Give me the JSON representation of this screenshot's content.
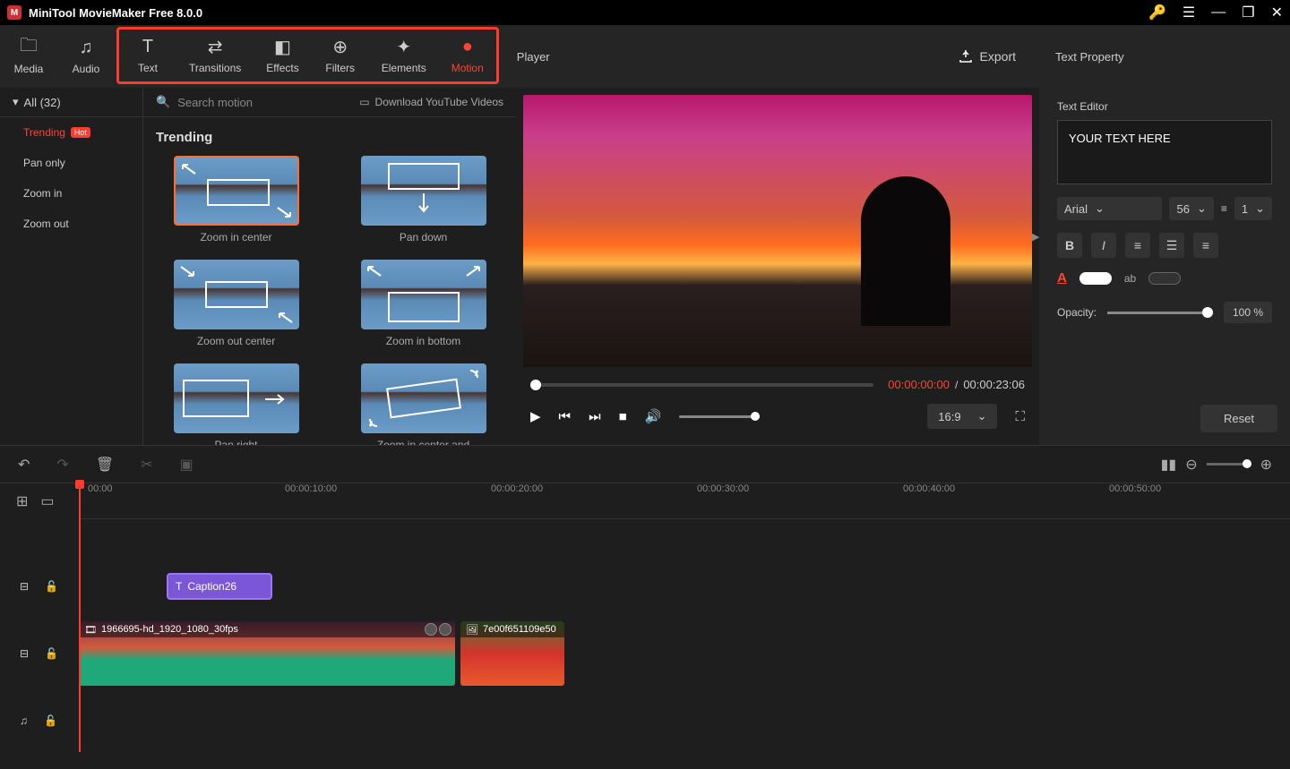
{
  "app": {
    "title": "MiniTool MovieMaker Free 8.0.0"
  },
  "tabs": {
    "media": "Media",
    "audio": "Audio",
    "text": "Text",
    "transitions": "Transitions",
    "effects": "Effects",
    "filters": "Filters",
    "elements": "Elements",
    "motion": "Motion"
  },
  "player_label": "Player",
  "export_label": "Export",
  "right_header": "Text Property",
  "categories": {
    "header": "All (32)",
    "items": [
      "Trending",
      "Pan only",
      "Zoom in",
      "Zoom out"
    ],
    "hot": "Hot"
  },
  "search": {
    "placeholder": "Search motion",
    "download": "Download YouTube Videos"
  },
  "motion_section": "Trending",
  "motions": [
    "Zoom in center",
    "Pan down",
    "Zoom out center",
    "Zoom in bottom",
    "Pan right",
    "Zoom in center and"
  ],
  "playback": {
    "current": "00:00:00:00",
    "sep": " / ",
    "total": "00:00:23:06",
    "aspect": "16:9"
  },
  "text_editor": {
    "label": "Text Editor",
    "content": "YOUR TEXT HERE",
    "font": "Arial",
    "size": "56",
    "spacing": "1",
    "opacity_label": "Opacity:",
    "opacity_value": "100 %",
    "reset": "Reset",
    "ab": "ab"
  },
  "timeline": {
    "ticks": [
      "00:00",
      "00:00:10:00",
      "00:00:20:00",
      "00:00:30:00",
      "00:00:40:00",
      "00:00:50:00"
    ],
    "caption_label": "Caption26",
    "clip1_name": "1966695-hd_1920_1080_30fps",
    "clip2_name": "7e00f651109e50"
  }
}
